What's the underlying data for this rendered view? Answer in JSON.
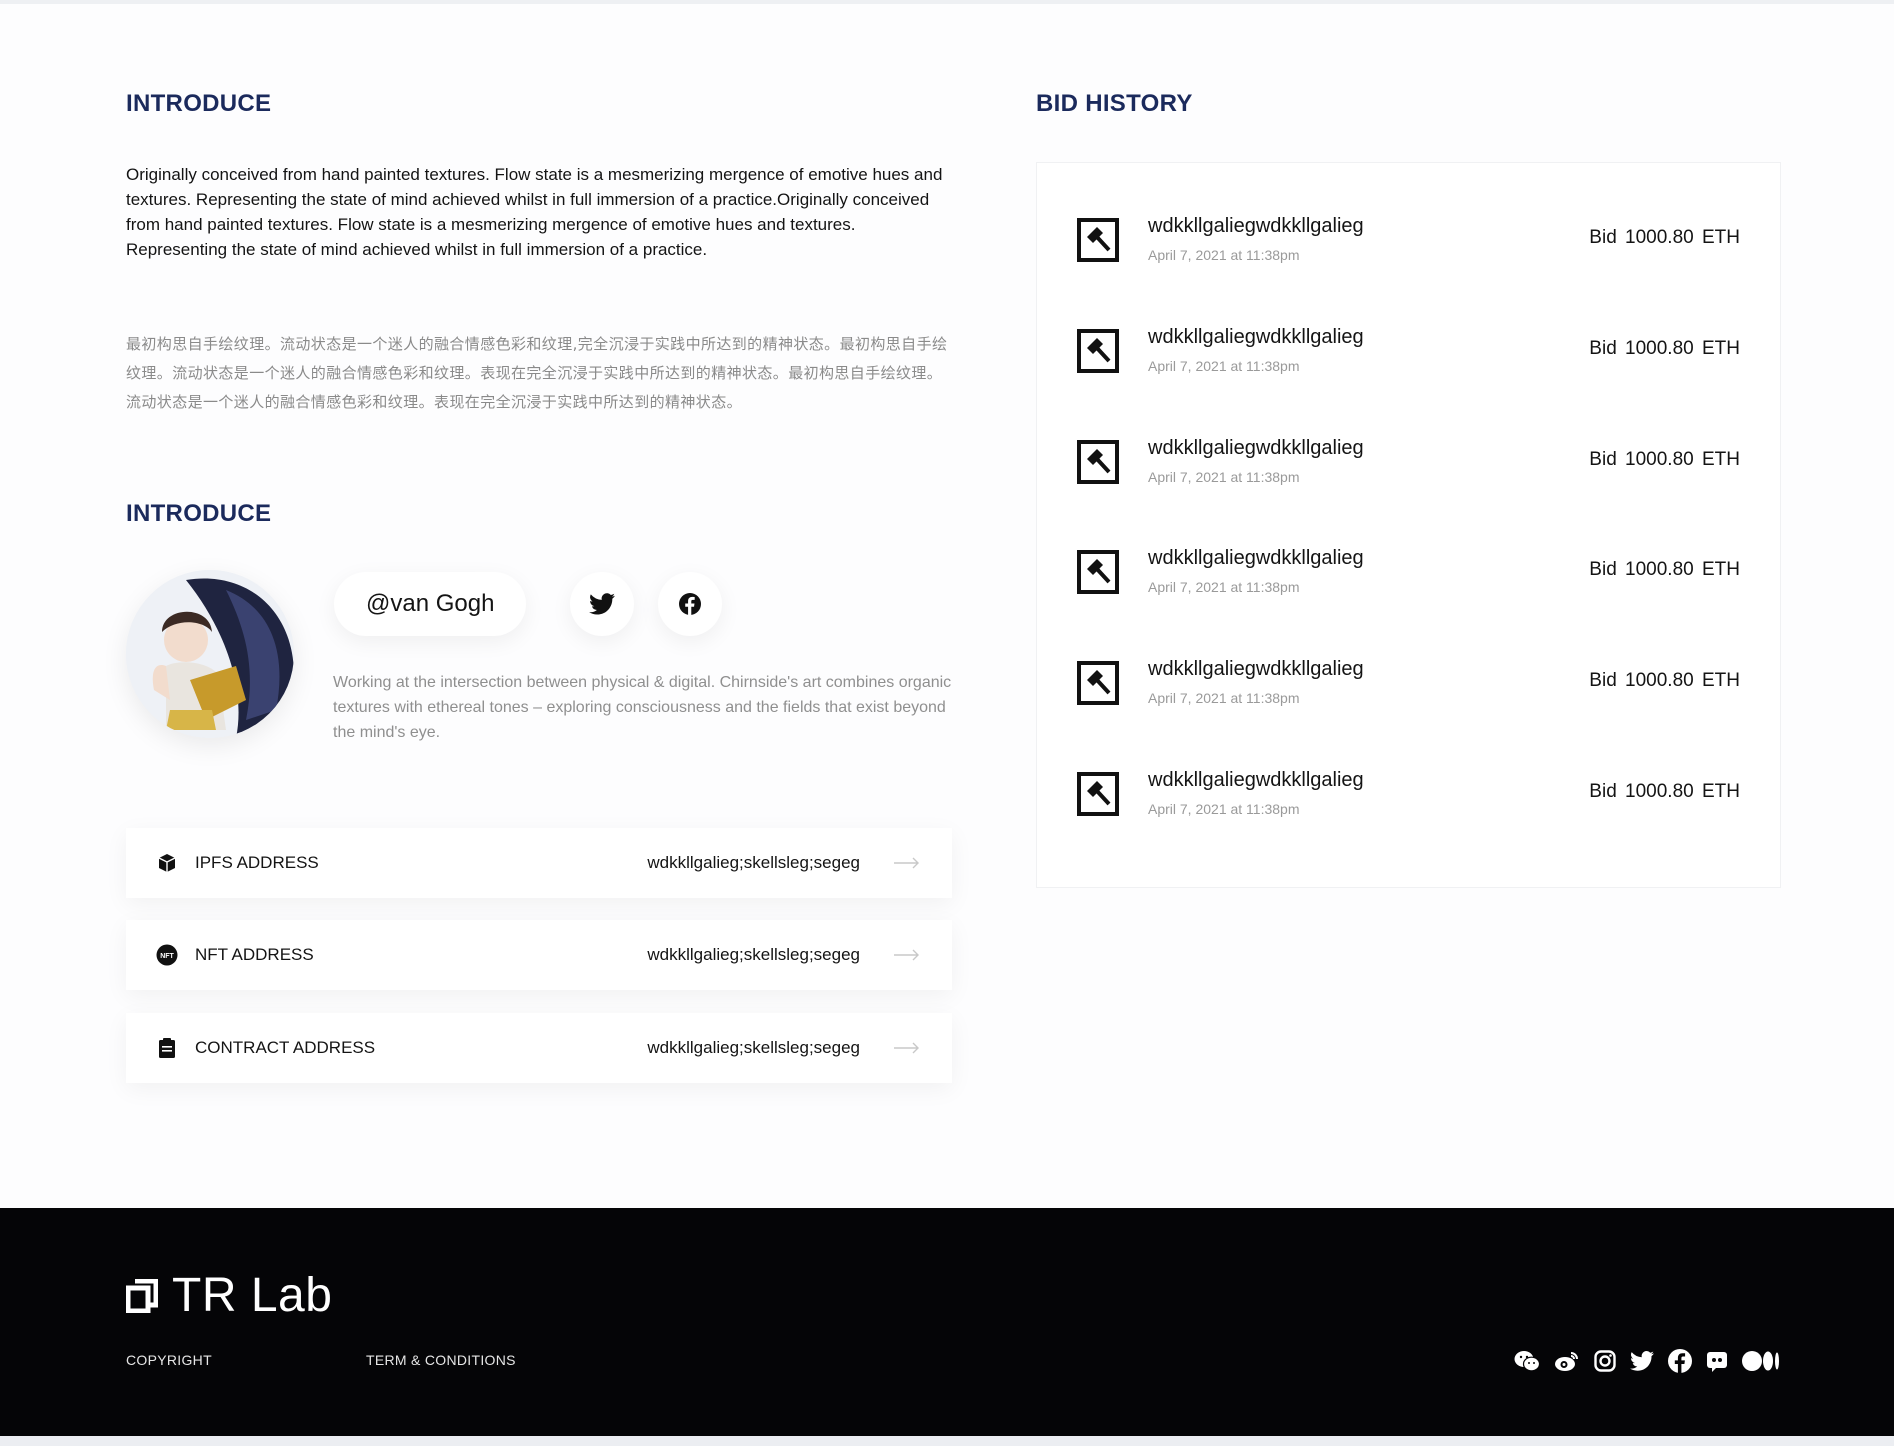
{
  "introduce": {
    "title": "INTRODUCE",
    "text_en": "Originally conceived from hand painted textures. Flow state is a mesmerizing mergence of emotive hues and textures. Representing the state of mind achieved whilst in full immersion of a practice.Originally conceived from hand painted textures. Flow state is a mesmerizing mergence of emotive hues and textures. Representing the state of mind achieved whilst in full immersion of a practice.",
    "text_cn": "最初构思自手绘纹理。流动状态是一个迷人的融合情感色彩和纹理,完全沉浸于实践中所达到的精神状态。最初构思自手绘纹理。流动状态是一个迷人的融合情感色彩和纹理。表现在完全沉浸于实践中所达到的精神状态。最初构思自手绘纹理。流动状态是一个迷人的融合情感色彩和纹理。表现在完全沉浸于实践中所达到的精神状态。"
  },
  "artist": {
    "title": "INTRODUCE",
    "handle": "@van Gogh",
    "bio": "Working at the intersection between physical & digital. Chirnside's art combines organic textures with ethereal tones – exploring consciousness and the fields that exist beyond the mind's eye.",
    "socials": [
      "twitter-icon",
      "facebook-icon"
    ]
  },
  "addresses": [
    {
      "label": "IPFS ADDRESS",
      "value": "wdkkllgalieg;skellsleg;segeg",
      "icon": "cube-icon"
    },
    {
      "label": "NFT ADDRESS",
      "value": "wdkkllgalieg;skellsleg;segeg",
      "icon": "nft-icon"
    },
    {
      "label": "CONTRACT ADDRESS",
      "value": "wdkkllgalieg;skellsleg;segeg",
      "icon": "clipboard-icon"
    }
  ],
  "bid_history": {
    "title": "BID HISTORY",
    "items": [
      {
        "name": "wdkkllgaliegwdkkllgalieg",
        "date": "April 7, 2021 at 11:38pm",
        "amount": "Bid 1000.80 ETH"
      },
      {
        "name": "wdkkllgaliegwdkkllgalieg",
        "date": "April 7, 2021 at 11:38pm",
        "amount": "Bid 1000.80 ETH"
      },
      {
        "name": "wdkkllgaliegwdkkllgalieg",
        "date": "April 7, 2021 at 11:38pm",
        "amount": "Bid 1000.80 ETH"
      },
      {
        "name": "wdkkllgaliegwdkkllgalieg",
        "date": "April 7, 2021 at 11:38pm",
        "amount": "Bid 1000.80 ETH"
      },
      {
        "name": "wdkkllgaliegwdkkllgalieg",
        "date": "April 7, 2021 at 11:38pm",
        "amount": "Bid 1000.80 ETH"
      },
      {
        "name": "wdkkllgaliegwdkkllgalieg",
        "date": "April 7, 2021 at 11:38pm",
        "amount": "Bid 1000.80 ETH"
      }
    ]
  },
  "footer": {
    "logo_text": "TR Lab",
    "copyright": "COPYRIGHT",
    "terms": "TERM & CONDITIONS",
    "socials": [
      "wechat-icon",
      "weibo-icon",
      "instagram-icon",
      "twitter-icon",
      "facebook-icon",
      "discord-icon",
      "medium-icon"
    ]
  },
  "colors": {
    "heading": "#1b2a5c",
    "footer_bg": "#050507",
    "muted_text": "#8f8f8f"
  }
}
